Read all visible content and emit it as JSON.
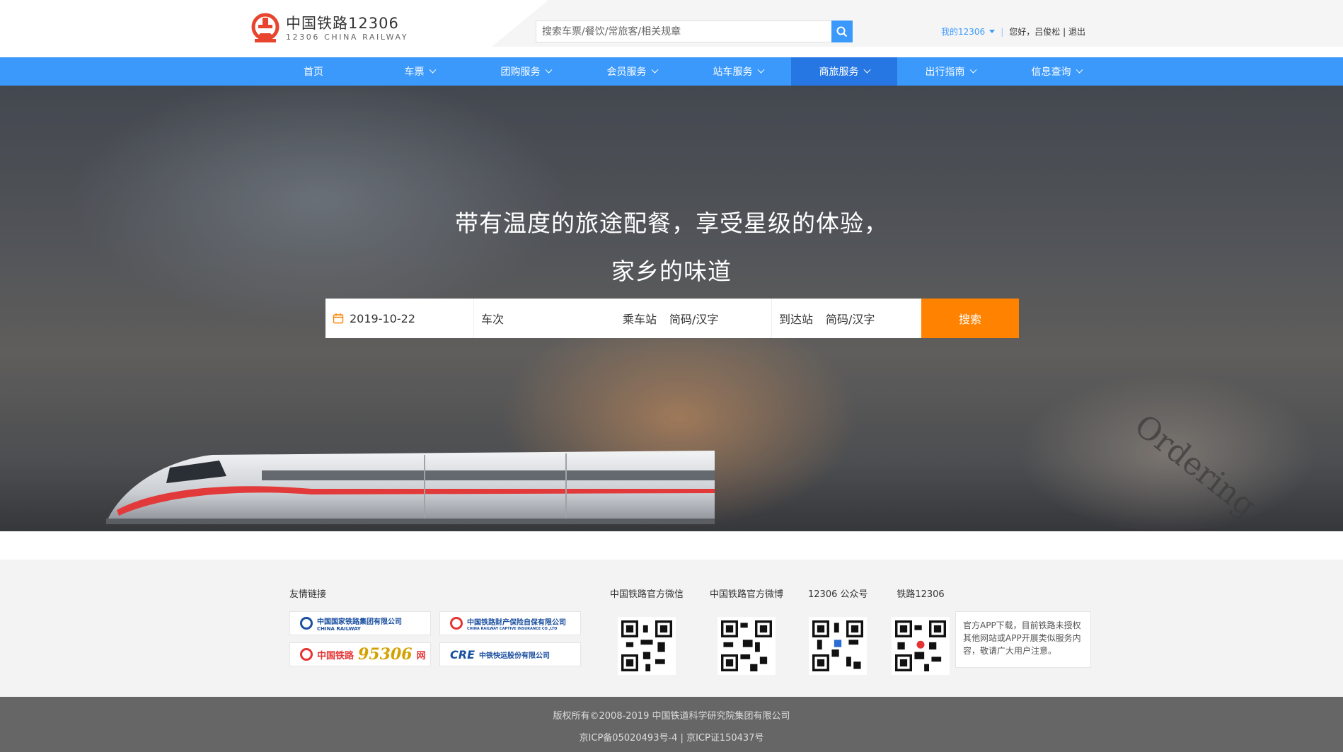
{
  "header": {
    "logo_title": "中国铁路12306",
    "logo_subtitle": "12306 CHINA RAILWAY",
    "search_placeholder": "搜索车票/餐饮/常旅客/相关规章",
    "my12306": "我的12306",
    "greeting": "您好，",
    "username": "吕俊松",
    "divider": "|",
    "logout": "退出",
    "accent_color": "#3b99fc"
  },
  "nav": {
    "items": [
      {
        "label": "首页",
        "dropdown": false
      },
      {
        "label": "车票",
        "dropdown": true
      },
      {
        "label": "团购服务",
        "dropdown": true
      },
      {
        "label": "会员服务",
        "dropdown": true
      },
      {
        "label": "站车服务",
        "dropdown": true
      },
      {
        "label": "商旅服务",
        "dropdown": true,
        "active": true
      },
      {
        "label": "出行指南",
        "dropdown": true
      },
      {
        "label": "信息查询",
        "dropdown": true
      }
    ]
  },
  "hero": {
    "title_line1": "带有温度的旅途配餐，享受星级的体验，",
    "title_line2": "家乡的味道",
    "decor_text": "Ordering",
    "form": {
      "date": "2019-10-22",
      "train_placeholder": "车次",
      "from_label": "乘车站",
      "from_placeholder": "简码/汉字",
      "to_label": "到达站",
      "to_placeholder": "简码/汉字",
      "search_button": "搜索",
      "button_color": "#ff8200"
    }
  },
  "footer": {
    "links_title": "友情链接",
    "links": [
      {
        "label": "中国国家铁路集团有限公司",
        "sub": "CHINA RAILWAY"
      },
      {
        "label": "中国铁路财产保险自保有限公司",
        "sub": "CHINA RAILWAY CAPTIVE INSURANCE CO.,LTD"
      },
      {
        "label": "中国铁路",
        "brand": "95306",
        "suffix": "网"
      },
      {
        "label": "CRE",
        "sub": "中铁快运股份有限公司"
      }
    ],
    "qr_codes": [
      {
        "label": "中国铁路官方微信"
      },
      {
        "label": "中国铁路官方微博"
      },
      {
        "label": "12306 公众号"
      },
      {
        "label": "铁路12306"
      }
    ],
    "app_note": "官方APP下载，目前铁路未授权其他网站或APP开展类似服务内容，敬请广大用户注意。"
  },
  "copyright": {
    "line1": "版权所有©2008-2019   中国铁道科学研究院集团有限公司",
    "line2": "京ICP备05020493号-4    |    京ICP证150437号"
  }
}
